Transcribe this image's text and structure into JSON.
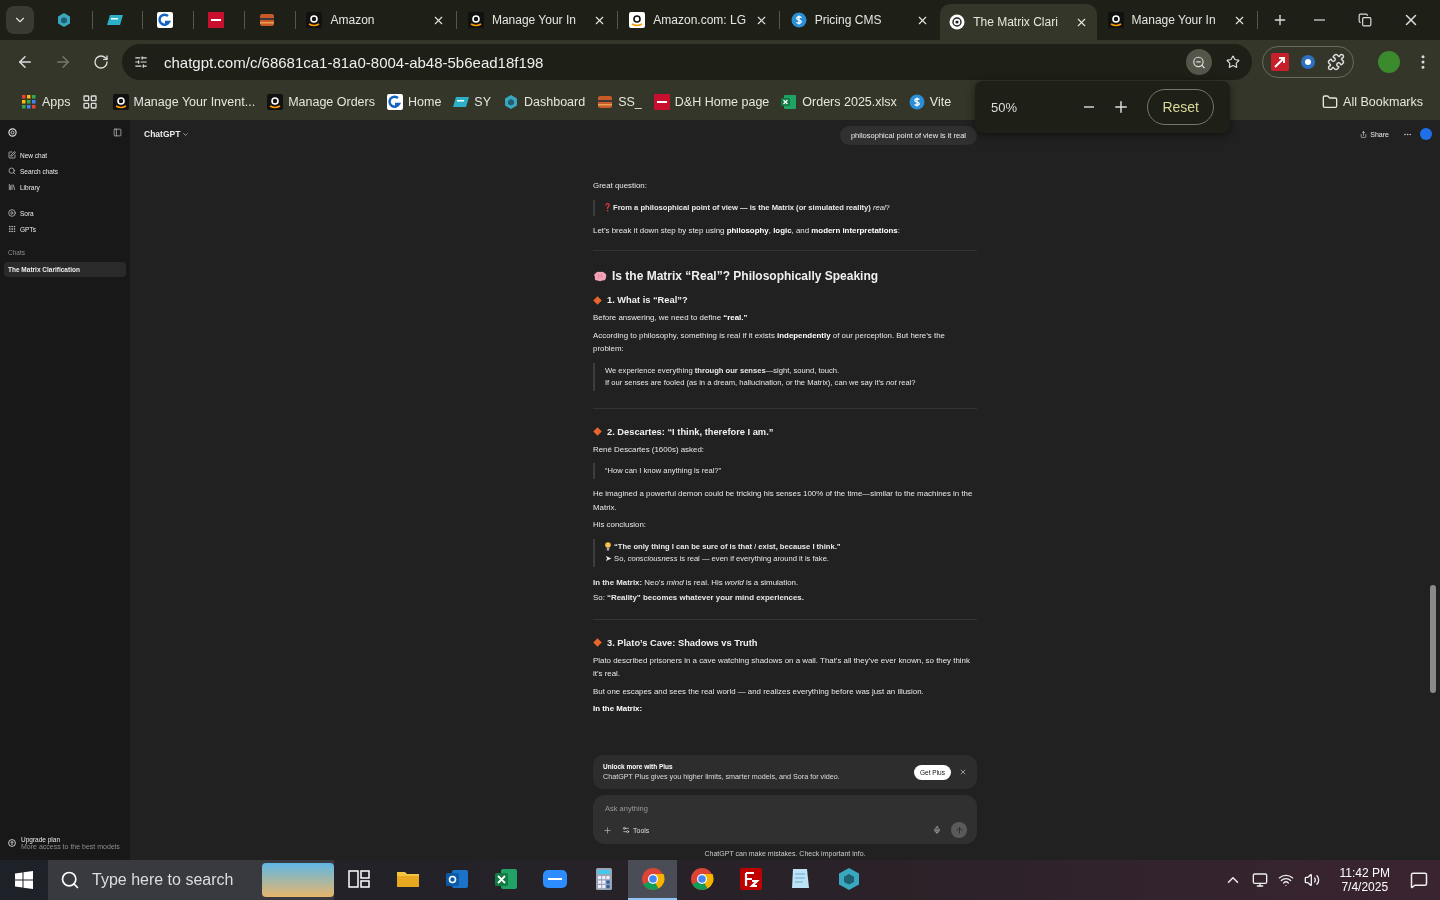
{
  "browser": {
    "tabs": [
      {
        "selected": false
      },
      {
        "selected": false
      },
      {
        "selected": false
      },
      {
        "selected": false
      },
      {
        "selected": false
      },
      {
        "selected": false,
        "title": "Amazon"
      },
      {
        "selected": false,
        "title": "Manage Your In"
      },
      {
        "selected": false,
        "title": "Amazon.com: LG"
      },
      {
        "selected": false,
        "title": "Pricing CMS"
      },
      {
        "selected": true,
        "title": "The Matrix Clari"
      },
      {
        "selected": false,
        "title": "Manage Your In"
      }
    ],
    "address": "chatgpt.com/c/68681ca1-81a0-8004-ab48-5b6ead18f198",
    "bookmarks": [
      "Apps",
      "Manage Your Invent...",
      "Manage Orders",
      "Home",
      "SY",
      "Dashboard",
      "SS_",
      "D&H Home page",
      "Orders 2025.xlsx",
      "Vite"
    ],
    "all_bookmarks": "All Bookmarks",
    "zoom_popup": {
      "value": "50%",
      "reset": "Reset"
    }
  },
  "sidebar": {
    "items": [
      "New chat",
      "Search chats",
      "Library",
      "Sora",
      "GPTs"
    ],
    "section": "Chats",
    "chats": [
      {
        "label": "The Matrix Clarification",
        "selected": true
      }
    ],
    "upgrade": {
      "title": "Upgrade plan",
      "subtitle": "More access to the best models"
    }
  },
  "header": {
    "model": "ChatGPT",
    "share": "Share"
  },
  "user_message": "philosophical point of view is it real",
  "answer": [
    {
      "kind": "p",
      "text": "Great question:"
    },
    {
      "kind": "quote",
      "lines": [
        "**From a philosophical point of view — is the Matrix (or simulated reality)** *real*?"
      ]
    },
    {
      "kind": "p",
      "text": "Let’s break it down step by step using **philosophy**, **logic**, and **modern interpretations**:"
    },
    {
      "kind": "hr"
    },
    {
      "kind": "h2",
      "text": "Is the Matrix “Real”? Philosophically Speaking"
    },
    {
      "kind": "h3",
      "text": "1. What is “Real”?"
    },
    {
      "kind": "p",
      "text": "Before answering, we need to define **“real.”**"
    },
    {
      "kind": "p",
      "text": "According to philosophy, something is real if it exists **independently** of our perception. But here’s the problem:"
    },
    {
      "kind": "quote",
      "lines": [
        "We experience everything **through our senses**—sight, sound, touch.",
        "If our senses are fooled (as in a dream, hallucination, or the Matrix), can we say it’s *not* real?"
      ]
    },
    {
      "kind": "hr"
    },
    {
      "kind": "h3",
      "text": "2. Descartes: “I think, therefore I am.”"
    },
    {
      "kind": "p",
      "text": "René Descartes (1600s) asked:"
    },
    {
      "kind": "quote",
      "lines": [
        "“How can I know anything is real?”"
      ]
    },
    {
      "kind": "p",
      "text": "He imagined a powerful demon could be tricking his senses 100% of the time—similar to the machines in the Matrix."
    },
    {
      "kind": "p",
      "text": "His conclusion:"
    },
    {
      "kind": "quote",
      "lines": [
        "**“The only thing I can be sure of is that** *I* **exist, because I think.”**",
        "➤ So, *consciousness* is real — even if everything around it is fake."
      ]
    },
    {
      "kind": "lines",
      "lines": [
        "**In the Matrix:** Neo’s *mind* is real. His *world* is a simulation.",
        "So: **“Reality” becomes whatever your mind experiences.**"
      ]
    },
    {
      "kind": "hr"
    },
    {
      "kind": "h3",
      "text": "3. Plato’s Cave: Shadows vs Truth"
    },
    {
      "kind": "p",
      "text": "Plato described prisoners in a cave watching shadows on a wall. That’s all they’ve ever known, so they think it’s real."
    },
    {
      "kind": "p",
      "text": "But one escapes and sees the real world — and realizes everything before was just an illusion."
    },
    {
      "kind": "p",
      "text": "**In the Matrix:**"
    }
  ],
  "plus_banner": {
    "title": "Unlock more with Plus",
    "text": "ChatGPT Plus gives you higher limits, smarter models, and Sora for video.",
    "button": "Get Plus"
  },
  "composer": {
    "placeholder": "Ask anything",
    "tools": "Tools"
  },
  "disclaimer": "ChatGPT can make mistakes. Check important info.",
  "taskbar": {
    "search_placeholder": "Type here to search",
    "apps": [
      {
        "selected": false
      },
      {
        "selected": false
      },
      {
        "selected": false
      },
      {
        "selected": false
      },
      {
        "selected": false
      },
      {
        "selected": false
      },
      {
        "selected": true
      },
      {
        "selected": false
      },
      {
        "selected": false
      },
      {
        "selected": false
      },
      {
        "selected": false
      }
    ],
    "time": "11:42 PM",
    "date": "7/4/2025"
  }
}
